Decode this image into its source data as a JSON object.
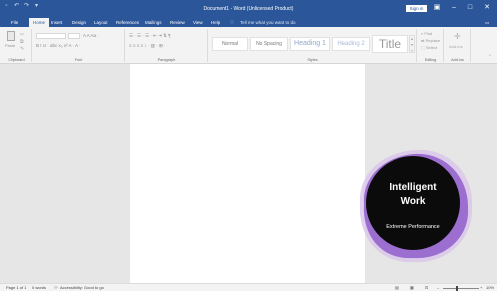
{
  "titlebar": {
    "title": "Document1 - Word (Unlicensed Product)",
    "signin_label": "Sign in",
    "qat_icons": [
      "save-icon",
      "undo-icon",
      "redo-icon",
      "customize-icon"
    ]
  },
  "tabs": [
    "File",
    "Home",
    "Insert",
    "Design",
    "Layout",
    "References",
    "Mailings",
    "Review",
    "View",
    "Help"
  ],
  "active_tab": "Home",
  "tellme": {
    "placeholder": "Tell me what you want to do"
  },
  "ribbon": {
    "groups": [
      "Clipboard",
      "Font",
      "Paragraph",
      "Styles",
      "Editing",
      "Add-ins"
    ],
    "clipboard_paste": "Paste",
    "font_row2": "B  I  U · abc x₂ x²  A · A ·",
    "font_row1_right": "A  A  Aa · ",
    "para_row1": "☰ · ☰ · ☰ · ⇤ ⇥ ⇅ ¶",
    "para_row2": "≡ ≡ ≡ ≡  ↕ ·  ▥ · ⊞ ·",
    "styles": [
      "Normal",
      "No Spacing",
      "Heading 1",
      "Heading 2",
      "Title"
    ],
    "editing": [
      "Find",
      "Replace",
      "Select"
    ],
    "addins": "Add-ins"
  },
  "statusbar": {
    "page": "Page 1 of 1",
    "words": "0 words",
    "accessibility": "Accessibility: Good to go",
    "zoom": "10%"
  },
  "ad": {
    "line1": "Intelligent",
    "line2": "Work",
    "subtitle": "Extreme Performance"
  },
  "colors": {
    "accent": "#2b579a",
    "ad_purple": "#9b6ed0"
  }
}
